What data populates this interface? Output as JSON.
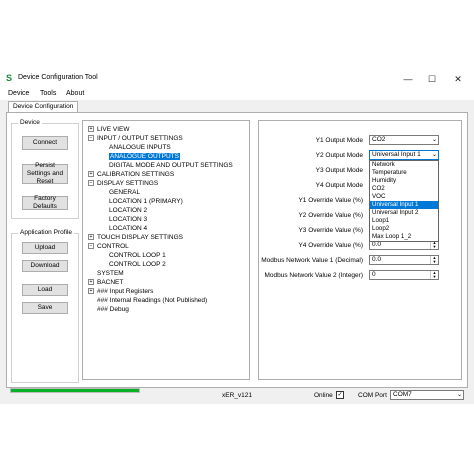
{
  "window": {
    "app_icon": "S",
    "title": "Device Configuration Tool",
    "controls": {
      "minimize": "—",
      "maximize": "☐",
      "close": "✕"
    }
  },
  "menu": [
    "Device",
    "Tools",
    "About"
  ],
  "tab": "Device Configuration",
  "device_group": {
    "title": "Device",
    "buttons": [
      "Connect",
      "Persist Settings and Reset",
      "Factory Defaults"
    ]
  },
  "profile_group": {
    "title": "Application Profile",
    "buttons": [
      "Upload",
      "Download",
      "Load",
      "Save"
    ]
  },
  "tree": [
    {
      "label": "LIVE VIEW",
      "level": 0,
      "expander": "+"
    },
    {
      "label": "INPUT / OUTPUT SETTINGS",
      "level": 0,
      "expander": "−"
    },
    {
      "label": "ANALOGUE INPUTS",
      "level": 1
    },
    {
      "label": "ANALOGUE OUTPUTS",
      "level": 1,
      "selected": true
    },
    {
      "label": "DIGITAL MODE AND OUTPUT SETTINGS",
      "level": 1
    },
    {
      "label": "CALIBRATION SETTINGS",
      "level": 0,
      "expander": "+"
    },
    {
      "label": "DISPLAY SETTINGS",
      "level": 0,
      "expander": "−"
    },
    {
      "label": "GENERAL",
      "level": 1
    },
    {
      "label": "LOCATION 1 (PRIMARY)",
      "level": 1
    },
    {
      "label": "LOCATION 2",
      "level": 1
    },
    {
      "label": "LOCATION 3",
      "level": 1
    },
    {
      "label": "LOCATION 4",
      "level": 1
    },
    {
      "label": "TOUCH DISPLAY SETTINGS",
      "level": 0,
      "expander": "+"
    },
    {
      "label": "CONTROL",
      "level": 0,
      "expander": "−"
    },
    {
      "label": "CONTROL LOOP 1",
      "level": 1
    },
    {
      "label": "CONTROL LOOP 2",
      "level": 1
    },
    {
      "label": "SYSTEM",
      "level": 0
    },
    {
      "label": "BACNET",
      "level": 0,
      "expander": "+"
    },
    {
      "label": "### Input Registers",
      "level": 0,
      "expander": "+"
    },
    {
      "label": "### Internal Readings (Not Published)",
      "level": 0
    },
    {
      "label": "### Debug",
      "level": 0
    }
  ],
  "properties": {
    "y1_mode": {
      "label": "Y1 Output Mode",
      "value": "CO2"
    },
    "y2_mode": {
      "label": "Y2 Output Mode",
      "value": "Universal Input 1"
    },
    "y3_mode": {
      "label": "Y3 Output Mode"
    },
    "y4_mode": {
      "label": "Y4 Output Mode"
    },
    "y1_override": {
      "label": "Y1 Override Value (%)"
    },
    "y2_override": {
      "label": "Y2 Override Value (%)"
    },
    "y3_override": {
      "label": "Y3 Override Value (%)"
    },
    "y4_override": {
      "label": "Y4 Override Value (%)",
      "value": "0.0"
    },
    "modbus_dec": {
      "label": "Modbus Network Value 1 (Decimal)",
      "value": "0.0"
    },
    "modbus_int": {
      "label": "Modbus Network Value 2 (Integer)",
      "value": "0"
    }
  },
  "dropdown": {
    "options": [
      "Network",
      "Temperature",
      "Humidity",
      "CO2",
      "VOC",
      "Universal Input 1",
      "Universal Input 2",
      "Loop1",
      "Loop2",
      "Max Loop 1_2"
    ],
    "selected_index": 5
  },
  "status": {
    "progress_percent": 100,
    "progress_color": "#06b025",
    "version": "xER_v121",
    "online_label": "Online",
    "online_checked": "✓",
    "com_label": "COM Port",
    "com_value": "COM7"
  },
  "colors": {
    "selection": "#0078d7"
  }
}
